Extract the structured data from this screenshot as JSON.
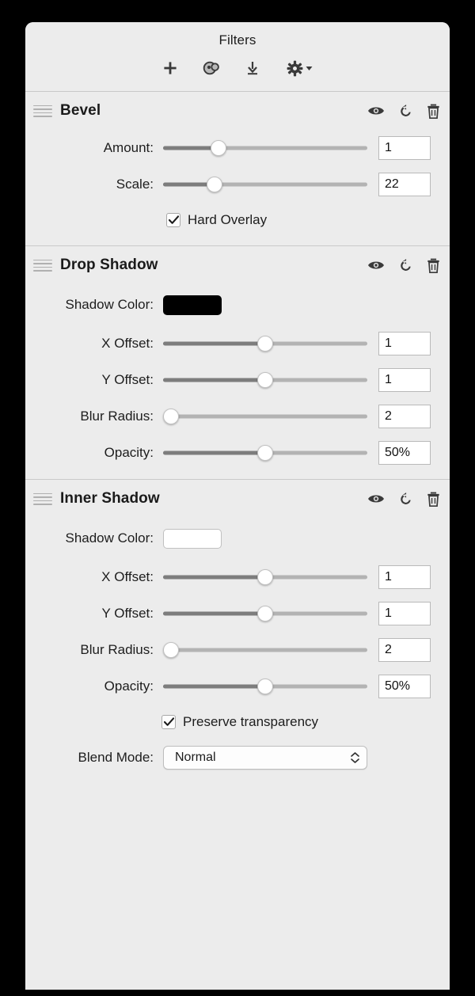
{
  "window": {
    "background": "#000000",
    "panel_background": "#ececec"
  },
  "header": {
    "title": "Filters",
    "toolbar": [
      {
        "name": "add-filter-button",
        "icon": "plus-icon"
      },
      {
        "name": "color-filter-button",
        "icon": "color-palette-icon"
      },
      {
        "name": "download-button",
        "icon": "download-icon"
      },
      {
        "name": "settings-button",
        "icon": "gear-icon"
      }
    ]
  },
  "section_actions": [
    {
      "name": "toggle-visibility-button",
      "icon": "eye-icon"
    },
    {
      "name": "reset-button",
      "icon": "reset-arrow-icon"
    },
    {
      "name": "delete-button",
      "icon": "trash-icon"
    }
  ],
  "sections": [
    {
      "title": "Bevel",
      "color_label": null,
      "color_value": null,
      "sliders": [
        {
          "label": "Amount:",
          "value": "1",
          "percent": 27
        },
        {
          "label": "Scale:",
          "value": "22",
          "percent": 25
        }
      ],
      "checkbox": {
        "label": "Hard Overlay",
        "checked": true
      },
      "blend_mode": null
    },
    {
      "title": "Drop Shadow",
      "color_label": "Shadow Color:",
      "color_value": "#000000",
      "sliders": [
        {
          "label": "X Offset:",
          "value": "1",
          "percent": 50
        },
        {
          "label": "Y Offset:",
          "value": "1",
          "percent": 50
        },
        {
          "label": "Blur Radius:",
          "value": "2",
          "percent": 4
        },
        {
          "label": "Opacity:",
          "value": "50%",
          "percent": 50
        }
      ],
      "checkbox": null,
      "blend_mode": null
    },
    {
      "title": "Inner Shadow",
      "color_label": "Shadow Color:",
      "color_value": "#ffffff",
      "sliders": [
        {
          "label": "X Offset:",
          "value": "1",
          "percent": 50
        },
        {
          "label": "Y Offset:",
          "value": "1",
          "percent": 50
        },
        {
          "label": "Blur Radius:",
          "value": "2",
          "percent": 4
        },
        {
          "label": "Opacity:",
          "value": "50%",
          "percent": 50
        }
      ],
      "checkbox": {
        "label": "Preserve transparency",
        "checked": true
      },
      "blend_mode": {
        "label": "Blend Mode:",
        "selected": "Normal"
      }
    }
  ]
}
